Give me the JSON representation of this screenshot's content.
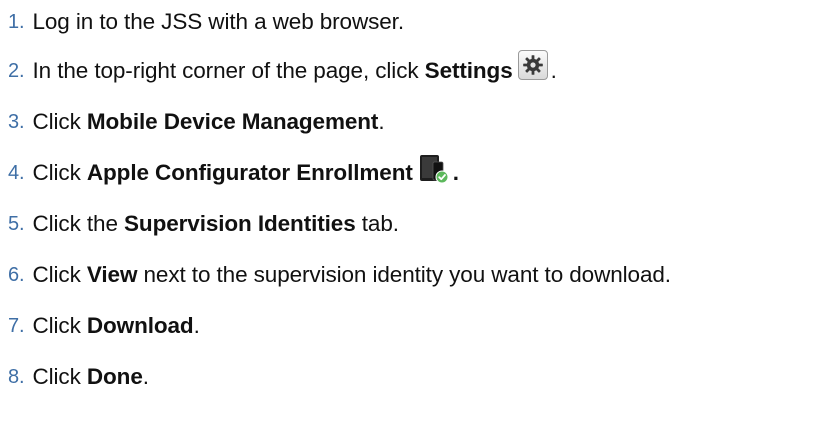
{
  "steps": [
    {
      "num": "1.",
      "pre": "Log in to the JSS with a web browser.",
      "bold": "",
      "post": ""
    },
    {
      "num": "2.",
      "pre": "In the top-right corner of the page, click ",
      "bold": "Settings",
      "post": "."
    },
    {
      "num": "3.",
      "pre": "Click ",
      "bold": "Mobile Device Management",
      "post": "."
    },
    {
      "num": "4.",
      "pre": "Click ",
      "bold": "Apple Configurator Enrollment",
      "post": "."
    },
    {
      "num": "5.",
      "pre": "Click the ",
      "bold": "Supervision Identities",
      "post": " tab."
    },
    {
      "num": "6.",
      "pre": "Click ",
      "bold": "View",
      "post": " next to the supervision identity you want to download."
    },
    {
      "num": "7.",
      "pre": "Click ",
      "bold": "Download",
      "post": "."
    },
    {
      "num": "8.",
      "pre": "Click ",
      "bold": "Done",
      "post": "."
    }
  ],
  "icons": {
    "settings": "gear-icon",
    "enrollment": "apple-configurator-enrollment-icon"
  },
  "colors": {
    "step_number": "#3f6fa6",
    "text": "#111111"
  }
}
